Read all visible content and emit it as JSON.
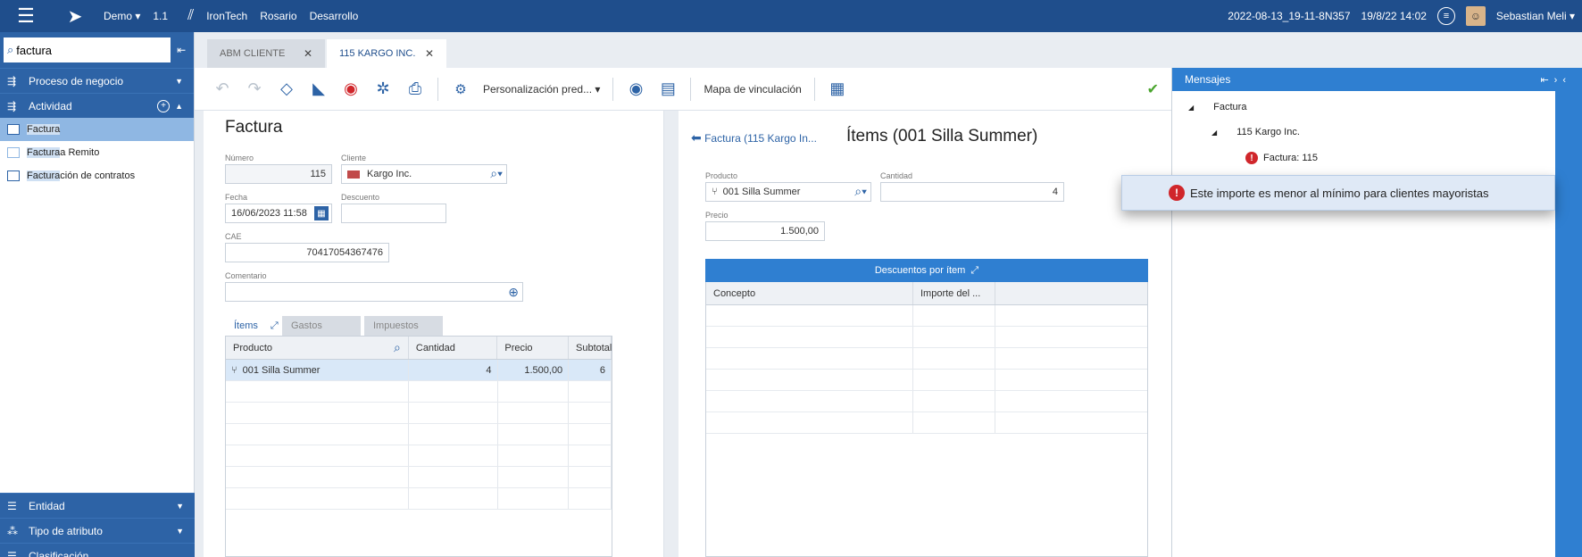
{
  "topbar": {
    "env": "Demo",
    "version": "1.1",
    "company": "IronTech",
    "branch": "Rosario",
    "stage": "Desarrollo",
    "build": "2022-08-13_19-11-8N357",
    "datetime": "19/8/22 14:02",
    "user": "Sebastian Meli"
  },
  "sidebar": {
    "search_value": "factura",
    "sections_top": [
      {
        "label": "Proceso de negocio"
      },
      {
        "label": "Actividad"
      }
    ],
    "items": [
      {
        "label": "Factura",
        "hl": "Factura",
        "rest": ""
      },
      {
        "label": "Factura a Remito",
        "hl": "Factura",
        "rest": " a Remito"
      },
      {
        "label": "Facturación de contratos",
        "hl": "Factura",
        "rest": "ción de contratos"
      }
    ],
    "sections_bottom": [
      {
        "label": "Entidad"
      },
      {
        "label": "Tipo de atributo"
      },
      {
        "label": "Clasificación"
      }
    ]
  },
  "tabs": [
    {
      "label": "ABM CLIENTE"
    },
    {
      "label": "115 KARGO INC."
    }
  ],
  "toolbar": {
    "personalization": "Personalización pred...",
    "linking_map": "Mapa de vinculación"
  },
  "form": {
    "title": "Factura",
    "numero_label": "Número",
    "numero_value": "115",
    "cliente_label": "Cliente",
    "cliente_value": "Kargo Inc.",
    "fecha_label": "Fecha",
    "fecha_value": "16/06/2023 11:58",
    "descuento_label": "Descuento",
    "descuento_value": "",
    "cae_label": "CAE",
    "cae_value": "70417054367476",
    "comentario_label": "Comentario",
    "comentario_value": "",
    "inner_tabs": [
      "Ítems",
      "Gastos",
      "Impuestos"
    ],
    "grid_headers": [
      "Producto",
      "Cantidad",
      "Precio",
      "Subtotal"
    ],
    "grid_rows": [
      {
        "producto": "001 Silla Summer",
        "cantidad": "4",
        "precio": "1.500,00",
        "subtotal": "6"
      }
    ]
  },
  "detail": {
    "back_link": "Factura (115 Kargo In...",
    "title": "Ítems (001 Silla Summer)",
    "producto_label": "Producto",
    "producto_value": "001 Silla Summer",
    "cantidad_label": "Cantidad",
    "cantidad_value": "4",
    "precio_label": "Precio",
    "precio_value": "1.500,00",
    "subgrid_title": "Descuentos por ítem",
    "subgrid_headers": [
      "Concepto",
      "Importe del ..."
    ]
  },
  "messages": {
    "title": "Mensajes",
    "tree": [
      "Factura",
      "115 Kargo Inc.",
      "Factura: 115"
    ],
    "tooltip": "Este importe es menor al mínimo para clientes mayoristas"
  },
  "colors": {
    "topbar": "#1f4e8c",
    "sidebar_section": "#2d63a6",
    "accent": "#2f7fd1",
    "error": "#d0262b"
  }
}
